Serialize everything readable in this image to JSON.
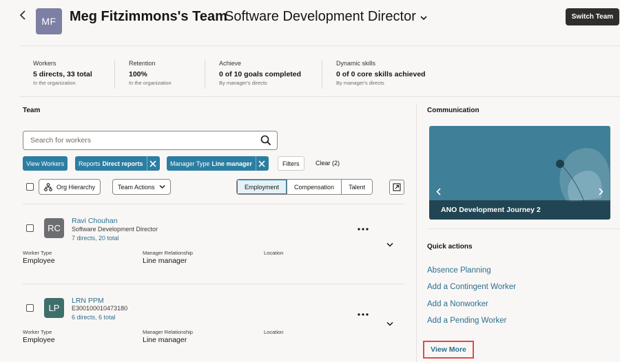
{
  "header": {
    "avatar_initials": "MF",
    "title": "Meg Fitzimmons's Team",
    "subtitle": "Software Development Director",
    "switch_label": "Switch Team"
  },
  "metrics": [
    {
      "label": "Workers",
      "value": "5 directs, 33 total",
      "sub": "In the organization"
    },
    {
      "label": "Retention",
      "value": "100%",
      "sub": "In the organization"
    },
    {
      "label": "Achieve",
      "value": "0 of 10 goals completed",
      "sub": "By manager's directs"
    },
    {
      "label": "Dynamic skills",
      "value": "0 of 0 core skills achieved",
      "sub": "By manager's directs"
    }
  ],
  "team": {
    "title": "Team",
    "search_placeholder": "Search for workers",
    "chips": {
      "view_workers": "View Workers",
      "reports_prefix": "Reports",
      "reports_value": "Direct reports",
      "manager_prefix": "Manager Type",
      "manager_value": "Line manager"
    },
    "filters_label": "Filters",
    "clear_label": "Clear (2)",
    "org_hierarchy_label": "Org Hierarchy",
    "team_actions_label": "Team Actions",
    "tabs": [
      "Employment",
      "Compensation",
      "Talent"
    ],
    "field_labels": {
      "worker_type": "Worker Type",
      "manager_relationship": "Manager Relationship",
      "location": "Location"
    },
    "workers": [
      {
        "initials": "RC",
        "name": "Ravi Chouhan",
        "title": "Software Development Director",
        "directs": "7 directs, 20 total",
        "worker_type": "Employee",
        "manager_relationship": "Line manager",
        "location": "",
        "avatar_color": "#6d6e72"
      },
      {
        "initials": "LP",
        "name": "LRN PPM",
        "title": "E300100010473180",
        "directs": "6 directs, 6 total",
        "worker_type": "Employee",
        "manager_relationship": "Line manager",
        "location": "",
        "avatar_color": "#3f6f6a"
      }
    ]
  },
  "communication": {
    "title": "Communication",
    "card_caption": "ANO Development Journey 2"
  },
  "quick_actions": {
    "title": "Quick actions",
    "items": [
      "Absence Planning",
      "Add a Contingent Worker",
      "Add a Nonworker",
      "Add a Pending Worker"
    ],
    "view_more": "View More"
  }
}
